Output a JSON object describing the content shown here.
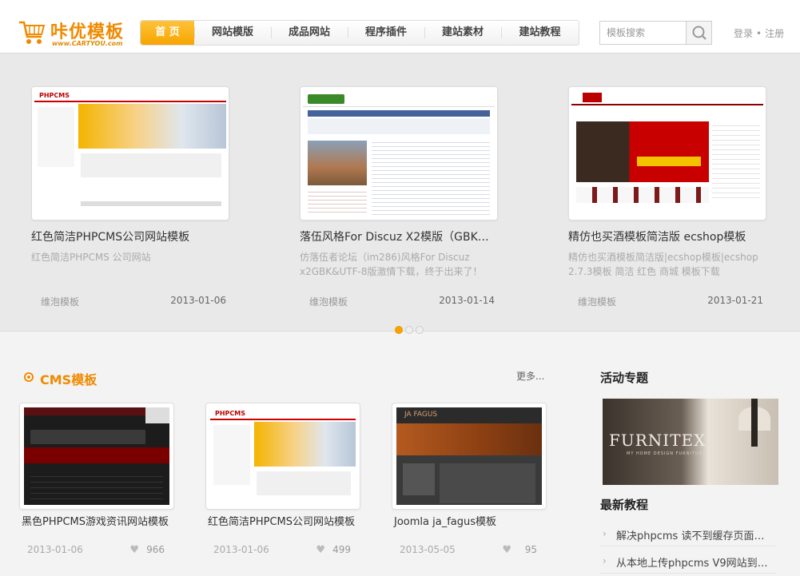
{
  "header": {
    "logo": {
      "name": "咔优模板",
      "url": "www.CARTYOU.com"
    },
    "nav": [
      {
        "label": "首 页",
        "active": true
      },
      {
        "label": "网站模版",
        "active": false
      },
      {
        "label": "成品网站",
        "active": false
      },
      {
        "label": "程序插件",
        "active": false
      },
      {
        "label": "建站素材",
        "active": false
      },
      {
        "label": "建站教程",
        "active": false
      }
    ],
    "search": {
      "placeholder": "模板搜索"
    },
    "auth": {
      "login": "登录",
      "separator": "•",
      "register": "注册"
    }
  },
  "carousel": {
    "slides": [
      {
        "title": "红色简洁PHPCMS公司网站模板",
        "desc": "红色简洁PHPCMS 公司网站",
        "author": "维泡模板",
        "date": "2013-01-06",
        "thumb_text": "PHPCMS"
      },
      {
        "title": "落伍风格For Discuz X2模版（GBK ...",
        "desc": "仿落伍者论坛（im286)风格For Discuz x2GBK&UTF-8版激情下载，终于出来了！我",
        "author": "维泡模板",
        "date": "2013-01-14"
      },
      {
        "title": "精仿也买酒模板简洁版 ecshop模板",
        "desc": "精仿也买酒模板简洁版|ecshop模板|ecshop 2.7.3模板 简洁 红色 商城 模板下载",
        "author": "维泡模板",
        "date": "2013-01-21"
      }
    ],
    "active_index": 0,
    "dot_count": 3
  },
  "cms": {
    "title": "CMS模板",
    "more": "更多...",
    "items": [
      {
        "title": "黑色PHPCMS游戏资讯网站模板",
        "date": "2013-01-06",
        "likes": "966"
      },
      {
        "title": "红色简洁PHPCMS公司网站模板",
        "date": "2013-01-06",
        "likes": "499",
        "thumb_text": "PHPCMS"
      },
      {
        "title": "Joomla ja_fagus模板",
        "date": "2013-05-05",
        "likes": "95",
        "thumb_text": "JA FAGUS"
      }
    ]
  },
  "sidebar": {
    "topics_title": "活动专题",
    "promo": {
      "brand": "FURNITEX",
      "sub": "MY HOME DESIGN FURNITURE"
    },
    "news_title": "最新教程",
    "news": [
      "解决phpcms 读不到缓存页面空...",
      "从本地上传phpcms V9网站到服..."
    ]
  },
  "colors": {
    "accent": "#f08a00",
    "nav_active": "#f7a400",
    "bg": "#f3f3f3"
  },
  "icons": {
    "cart": "shopping-cart-icon",
    "search": "search-icon",
    "heart": "heart-icon",
    "chevron": "chevron-right-icon"
  }
}
